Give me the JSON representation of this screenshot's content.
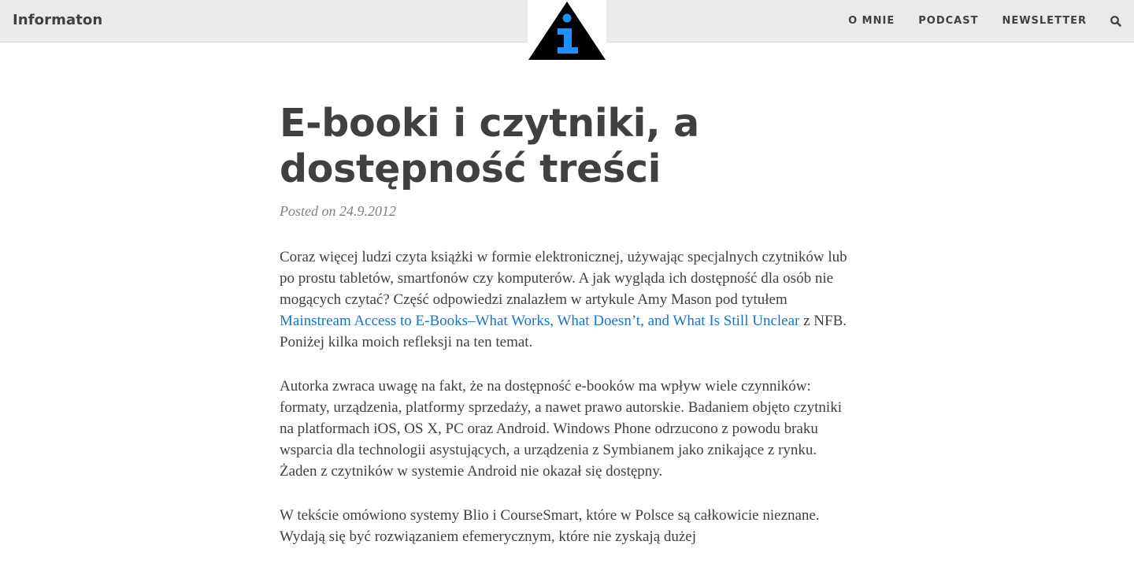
{
  "navbar": {
    "brand": "Informaton",
    "links": [
      "O MNIE",
      "PODCAST",
      "NEWSLETTER"
    ],
    "search_icon": "search-icon",
    "logo_icon": "info-triangle-icon",
    "logo_colors": {
      "triangle": "#000000",
      "glyph": "#1e90ff"
    }
  },
  "post": {
    "title": "E-booki i czytniki, a dostępność treści",
    "meta": "Posted on 24.9.2012",
    "p1_a": "Coraz więcej ludzi czyta książki w formie elektronicznej, używając specjalnych czytników lub po prostu tabletów, smartfonów czy komputerów. A jak wygląda ich dostępność dla osób nie mogących czytać? Część odpowiedzi znalazłem w artykule Amy Mason pod tytułem ",
    "p1_link": "Mainstream Access to E-Books–What Works, What Doesn’t, and What Is Still Unclear",
    "p1_b": " z NFB. Poniżej kilka moich refleksji na ten temat.",
    "p2": "Autorka zwraca uwagę na fakt, że na dostępność e-booków ma wpływ wiele czynników: formaty, urządzenia, platformy sprzedaży, a nawet prawo autorskie. Badaniem objęto czytniki na platformach iOS, OS X, PC oraz Android. Windows Phone odrzucono z powodu braku wsparcia dla technologii asystujących, a urządzenia z Symbianem jako znikające z rynku. Żaden z czytników w systemie Android nie okazał się dostępny.",
    "p3": "W tekście omówiono systemy Blio i CourseSmart, które w Polsce są całkowicie nieznane. Wydają się być rozwiązaniem efemerycznym, które nie zyskają dużej"
  },
  "colors": {
    "navbar_bg": "#eaeaea",
    "text": "#404040",
    "meta": "#808080",
    "link": "#1a73c8"
  }
}
